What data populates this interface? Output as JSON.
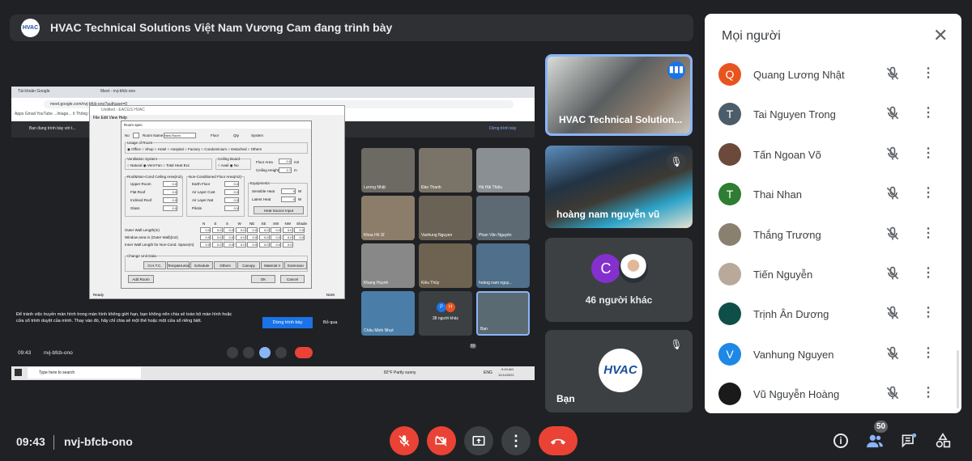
{
  "header": {
    "presenter_text": "HVAC Technical Solutions Việt Nam Vương Cam đang trình bày",
    "logo_text": "HVAC"
  },
  "shared_screen": {
    "browser_tabs": [
      "Tài khoản Google",
      "Meet - nvj-bfcb-ono"
    ],
    "url": "meet.google.com/nvj-bfcb-ono?authuser=0",
    "bookmarks": "Apps   Gmail   YouTube            ...Image...   ô Thông báo   Bài 1 - Tác dụng t...   Reading list",
    "presenting_notice": "Bạn đang trình bày với t...",
    "stop_presenting_top": "Dừng trình bày",
    "window_title": "Untitled - EACGS HVAC",
    "window_menu": "File  Edit  View  Help",
    "dialog": {
      "title": "Room spec",
      "no_label": "No",
      "no_value": "1",
      "room_name_label": "Room Name",
      "room_name_value": "New Room",
      "floor_label": "Floor",
      "floor_value": "1",
      "qty_label": "Qty",
      "qty_value": "1",
      "system_label": "System",
      "system_value": "1",
      "usage_label": "Usage of Room",
      "usage_options": "◉ Office  ○ Shop  ○ Hotel  ○ Hospital  ○ Factory  ○ Condominium  ○ Detached  ○ Others",
      "ventilation_label": "Ventilation System",
      "ventilation_options": "○ Natural  ◉ Vent Fan  ○ Total Heat Exc",
      "ceiling_board_label": "Ceiling Board",
      "ceiling_board_options": "○ Avail  ◉ No",
      "floor_area_label": "Floor Area",
      "floor_area_value": "0.0",
      "floor_area_unit": "m2",
      "ceiling_height_label": "Ceiling Height",
      "ceiling_height_value": "2.7",
      "ceiling_height_unit": "m",
      "roof_label": "Roof&Non-Cond Ceiling Area(m2)",
      "roof_rows": [
        [
          "Upper Room",
          "0.0"
        ],
        [
          "Flat Roof",
          "0.0"
        ],
        [
          "Inclined Roof",
          "0.0"
        ],
        [
          "Glass",
          "0.0"
        ]
      ],
      "noncond_label": "Non-Conditioned Floor Area(m2)",
      "noncond_rows": [
        [
          "Earth Floor",
          "0.0"
        ],
        [
          "Air Layer Cust",
          "0.0"
        ],
        [
          "Air Layer Nat",
          "0.0"
        ],
        [
          "Pilotis",
          "0.0"
        ]
      ],
      "equipment_label": "Equipments",
      "equipment_rows": [
        [
          "Sensible Heat",
          "0",
          "W"
        ],
        [
          "Latent Heat",
          "0",
          "W"
        ]
      ],
      "heat_source_button": "Heat Source Input",
      "dir_headers": [
        "N",
        "E",
        "S",
        "W",
        "NE",
        "SE",
        "SW",
        "NW",
        "Shade"
      ],
      "wall_rows": [
        "Outer Wall Length(m)",
        "Window area m (Outer Wall)(m2)",
        "Inner Wall Length for Non-Cond. Space(m)"
      ],
      "wall_value": "0.0",
      "unit_data_label": "Change Unit Data",
      "unit_buttons": [
        "O.H.T.C.",
        "Temp&Humid",
        "Schedule",
        "Others",
        "Canopy",
        "Material II",
        "Extension"
      ],
      "add_room": "Add Room",
      "ok": "OK",
      "cancel": "Cancel",
      "status_ready": "Ready",
      "status_num": "NUM"
    },
    "tiles": [
      {
        "name": "Lương Nhật"
      },
      {
        "name": "Đào Thanh"
      },
      {
        "name": "Hà Hải Thiệu"
      },
      {
        "name": "Khoa Hồ Sĩ"
      },
      {
        "name": "Vanhung Nguyen"
      },
      {
        "name": "Phan Văn Nguyên"
      },
      {
        "name": "Khang Huynh"
      },
      {
        "name": "Kiều Thủy"
      },
      {
        "name": "hoàng nam nguy..."
      },
      {
        "name": "Châu Minh Nhựt"
      },
      {
        "name": "38 người khác",
        "initials": [
          "P",
          "H"
        ]
      },
      {
        "name": "Bạn"
      }
    ],
    "banner_text": "Để tránh việc truyền màn hình trong màn hình không giới hạn, bạn không nên chia sẻ toàn bộ màn hình hoặc cửa sổ trình duyệt của mình. Thay vào đó, hãy chỉ chia sẻ một thẻ hoặc một cửa sổ riêng biệt.",
    "stop_presenting_button": "Dừng trình bày",
    "skip_button": "Bỏ qua",
    "meeting_time": "09:43",
    "meeting_code": "nvj-bfcb-ono",
    "people_count": "50",
    "taskbar_search": "Type here to search",
    "weather": "82°F  Partly sunny",
    "lang": "ENG",
    "clock": "9:43 AM",
    "date": "11/14/2021"
  },
  "side_tiles": [
    {
      "name": "HVAC Technical Solution...",
      "speaking": true
    },
    {
      "name": "hoàng nam nguyễn vũ",
      "muted": true
    },
    {
      "name": "46 người khác",
      "initial": "C",
      "initial_color": "#8430ce"
    },
    {
      "name": "Bạn",
      "muted": true,
      "logo_text": "HVAC"
    }
  ],
  "people_panel": {
    "title": "Mọi người",
    "participants": [
      {
        "name": "Quang Lương Nhật",
        "initial": "Q",
        "color": "#e8541f"
      },
      {
        "name": "Tai Nguyen Trong",
        "initial": "T",
        "color": "#4b5d6b"
      },
      {
        "name": "Tấn Ngoan Võ",
        "initial": "",
        "color": "#6b4a3c"
      },
      {
        "name": "Thai Nhan",
        "initial": "T",
        "color": "#2e7d32"
      },
      {
        "name": "Thắng Trương",
        "initial": "",
        "color": "#8a8070"
      },
      {
        "name": "Tiến Nguyễn",
        "initial": "",
        "color": "#b9a99a"
      },
      {
        "name": "Trịnh Ân Dương",
        "initial": "",
        "color": "#0f4f4a"
      },
      {
        "name": "Vanhung Nguyen",
        "initial": "V",
        "color": "#1e88e5"
      },
      {
        "name": "Vũ Nguyễn Hoàng",
        "initial": "",
        "color": "#1a1a1a"
      }
    ]
  },
  "bottom_bar": {
    "time": "09:43",
    "meeting_code": "nvj-bfcb-ono",
    "people_badge": "50"
  },
  "colors": {
    "end_call": "#ea4335",
    "muted_button": "#ea4335",
    "accent": "#8ab4f8",
    "background": "#202124"
  }
}
